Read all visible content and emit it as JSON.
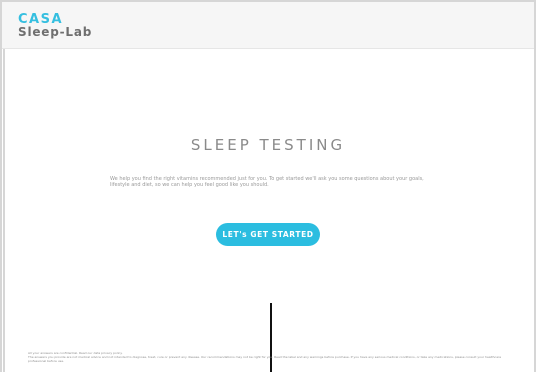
{
  "header": {
    "logo_line1": "CASA",
    "logo_line2": "Sleep-Lab"
  },
  "main": {
    "title": "SLEEP TESTING",
    "intro": "We help you find the right vitamins recommended just for you. To get started we'll ask you some questions about your goals, lifestyle and diet, so we can help you feel good like you should.",
    "cta_label": "LET's GET STARTED"
  },
  "footer": {
    "line1": "All your answers are confidential. Read our data privacy policy.",
    "line2": "The answers you provide are not medical advice and not intended to diagnose, treat, cure or prevent any disease. Our recommendations may not be right for you. Read the label and any warnings before purchase. If you have any serious medical conditions, or take any medications, please consult your healthcare professional before use."
  },
  "colors": {
    "accent": "#2bbde0",
    "logo_gray": "#6f6f6f",
    "header_bg": "#f6f6f6"
  }
}
